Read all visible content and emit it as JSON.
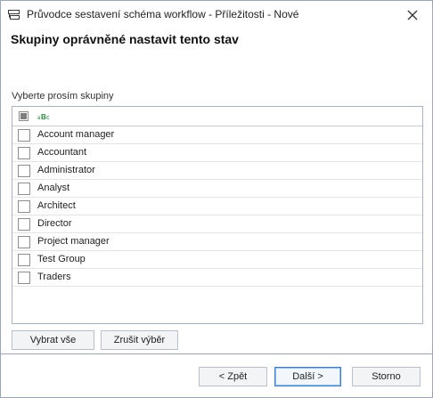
{
  "window": {
    "title": "Průvodce sestavení schéma workflow - Příležitosti - Nové"
  },
  "header": {
    "title": "Skupiny oprávněné nastavit tento stav"
  },
  "groups_section": {
    "label": "Vyberte prosím skupiny",
    "items": [
      {
        "label": "Account manager",
        "checked": false
      },
      {
        "label": "Accountant",
        "checked": false
      },
      {
        "label": "Administrator",
        "checked": false
      },
      {
        "label": "Analyst",
        "checked": false
      },
      {
        "label": "Architect",
        "checked": false
      },
      {
        "label": "Director",
        "checked": false
      },
      {
        "label": "Project manager",
        "checked": false
      },
      {
        "label": "Test Group",
        "checked": false
      },
      {
        "label": "Traders",
        "checked": false
      }
    ]
  },
  "selection_buttons": {
    "select_all": "Vybrat vše",
    "clear_selection": "Zrušit výběr"
  },
  "footer": {
    "back": "< Zpět",
    "next": "Další >",
    "cancel": "Storno"
  },
  "icons": {
    "title": "workflow-icon",
    "close": "close-icon",
    "column": "abc-text-column-icon"
  }
}
